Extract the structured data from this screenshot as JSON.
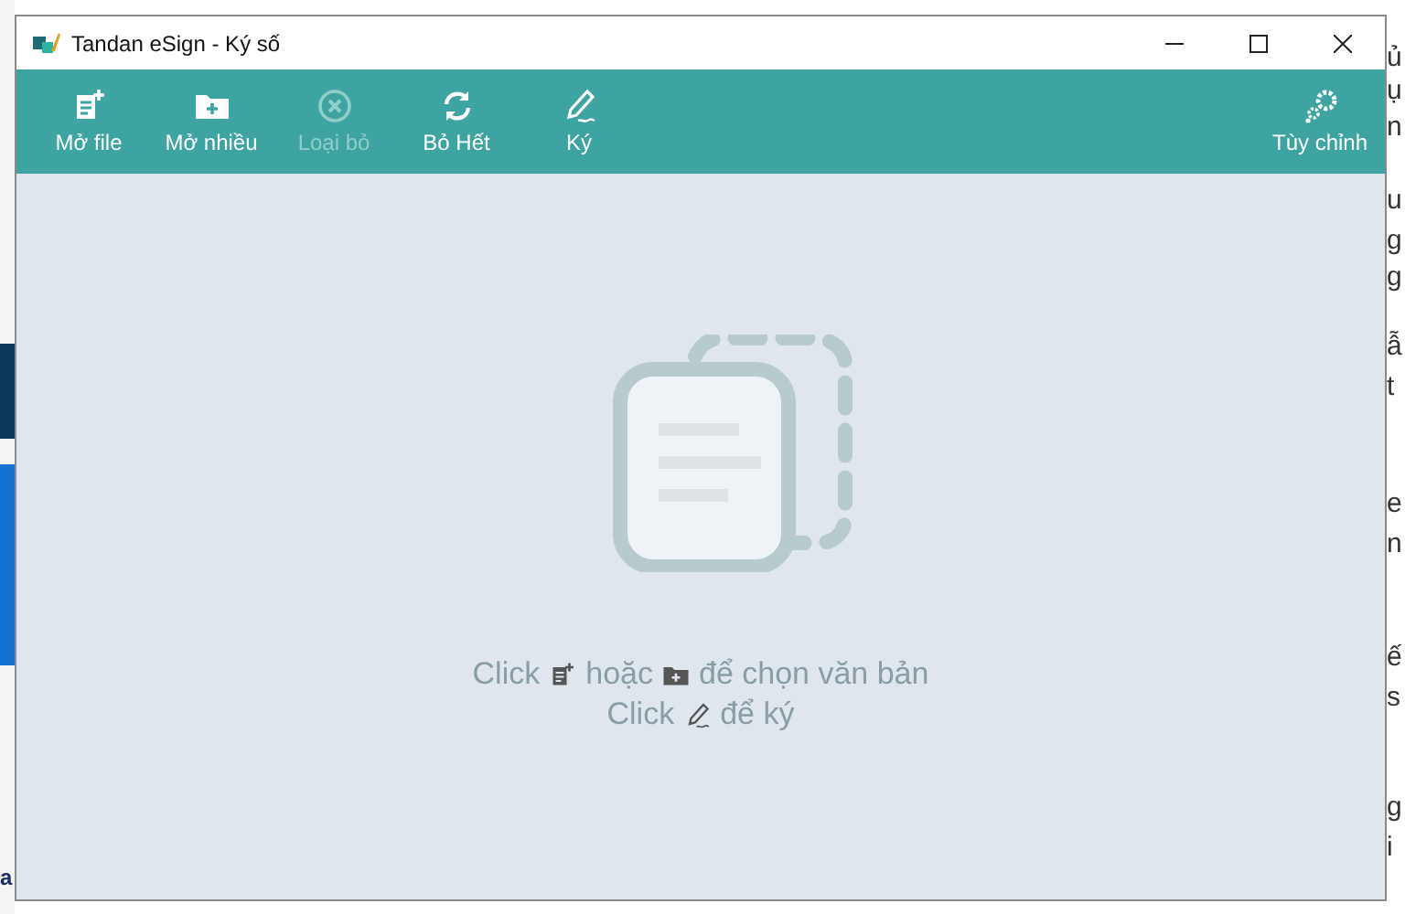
{
  "window": {
    "title": "Tandan eSign - Ký số"
  },
  "toolbar": [
    {
      "label": "Mở file",
      "disabled": false
    },
    {
      "label": "Mở nhiều",
      "disabled": false
    },
    {
      "label": "Loại bỏ",
      "disabled": true
    },
    {
      "label": "Bỏ Hết",
      "disabled": false
    },
    {
      "label": "Ký",
      "disabled": false
    }
  ],
  "settings_button": {
    "label": "Tùy chỉnh"
  },
  "hint_lines": [
    {
      "parts": [
        {
          "kind": "text",
          "text": "Click"
        },
        {
          "kind": "icon"
        },
        {
          "kind": "text",
          "text": "hoặc"
        },
        {
          "kind": "icon"
        },
        {
          "kind": "text",
          "text": "để chọn văn bản"
        }
      ]
    },
    {
      "parts": [
        {
          "kind": "text",
          "text": "Click"
        },
        {
          "kind": "icon"
        },
        {
          "kind": "text",
          "text": "để ký"
        }
      ]
    }
  ],
  "background_window": {
    "left_fragments": [
      "a"
    ],
    "right_fragments": [
      "ủ",
      "ụ",
      "n",
      "u",
      "g",
      "g",
      "ẫ",
      "t",
      "e",
      "n",
      "ế",
      "s",
      "g",
      "i"
    ]
  }
}
